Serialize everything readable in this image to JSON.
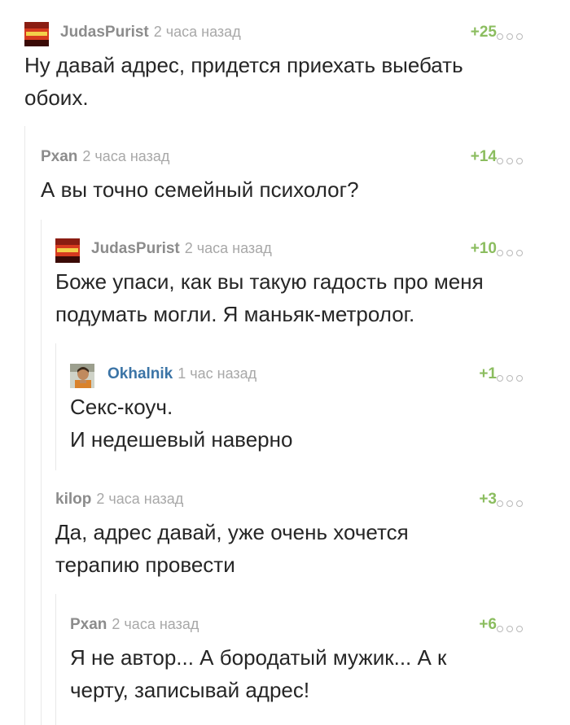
{
  "comments": [
    {
      "author": "JudasPurist",
      "time": "2 часа назад",
      "rating": "+25",
      "lines": [
        "Ну давай адрес, придется приехать выебать",
        "обоих."
      ]
    },
    {
      "author": "Pxan",
      "time": "2 часа назад",
      "rating": "+14",
      "lines": [
        "А вы точно семейный психолог?"
      ]
    },
    {
      "author": "JudasPurist",
      "time": "2 часа назад",
      "rating": "+10",
      "lines": [
        "Боже упаси, как вы такую гадость про меня",
        "подумать могли. Я маньяк-метролог."
      ]
    },
    {
      "author": "Okhalnik",
      "time": "1 час назад",
      "rating": "+1",
      "lines": [
        "Секс-коуч.",
        "И недешевый наверно"
      ]
    },
    {
      "author": "kilop",
      "time": "2 часа назад",
      "rating": "+3",
      "lines": [
        "Да, адрес давай, уже очень хочется",
        "терапию провести"
      ]
    },
    {
      "author": "Pxan",
      "time": "2 часа назад",
      "rating": "+6",
      "lines": [
        "Я не автор... А бородатый мужик... А к",
        "черту, записывай адрес!"
      ]
    }
  ],
  "icons": {
    "more": "more-dots-icon"
  },
  "colors": {
    "rating": "#8bbd5f",
    "author": "#8c8c8c",
    "author_highlight": "#3b74a6",
    "time": "#a8a8a8"
  }
}
